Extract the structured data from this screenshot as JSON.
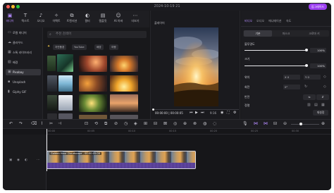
{
  "window": {
    "title": "2024-10-19 21",
    "upgrade_label": "업그레이드"
  },
  "toolbar": {
    "tools": [
      {
        "label": "미디어",
        "icon": "media-icon"
      },
      {
        "label": "텍스트",
        "icon": "text-icon"
      },
      {
        "label": "오디오",
        "icon": "audio-icon"
      },
      {
        "label": "이펙트",
        "icon": "effects-icon"
      },
      {
        "label": "트랜지션",
        "icon": "transitions-icon"
      },
      {
        "label": "필터",
        "icon": "filter-icon"
      },
      {
        "label": "템플릿",
        "icon": "template-icon"
      },
      {
        "label": "AI 아바",
        "icon": "ai-icon"
      },
      {
        "label": "더보기",
        "icon": "more-icon"
      }
    ]
  },
  "leftnav": {
    "items": [
      {
        "label": "로컬 미디어"
      },
      {
        "label": "클라우드"
      },
      {
        "label": "스톡 라이브러리"
      },
      {
        "label": "배경"
      },
      {
        "label": "Pixabay"
      },
      {
        "label": "Unsplash"
      },
      {
        "label": "Giphy GIF"
      }
    ]
  },
  "media": {
    "search_placeholder": "추천 검색어",
    "chips": [
      "자연풍경",
      "YouTube",
      "배경",
      "여행"
    ]
  },
  "player": {
    "label": "플레이어",
    "timecode": "00:00:00 | 00:00:05",
    "ratio": "9:16"
  },
  "inspector": {
    "tabs": [
      "비디오",
      "오디오",
      "애니메이션",
      "속도"
    ],
    "segments": [
      "기본",
      "마스크",
      "크로마 키"
    ],
    "props": {
      "opacity_label": "불투명도",
      "opacity_value": "100%",
      "scale_label": "크기",
      "scale_value": "100%",
      "position_label": "위치",
      "x_label": "X",
      "x_value": "0",
      "y_label": "Y",
      "y_value": "0",
      "rotate_label": "회전",
      "rotate_value": "0°",
      "flip_label": "반전",
      "align_label": "정렬",
      "blend_label": "혼합 모드",
      "reset_label": "재설정"
    },
    "opacity": 1.0,
    "scale": 1.0
  },
  "timeline": {
    "ruler_labels": [
      "00:00",
      "00:05",
      "00:10",
      "00:15",
      "00:20",
      "00:25",
      "00:30"
    ],
    "clip_label": "Golden Hour Cloudscape - 00:00:05:00",
    "playhead_time": 0
  },
  "colors": {
    "accent": "#9b3ff0",
    "clip": "#5c3fa0"
  }
}
